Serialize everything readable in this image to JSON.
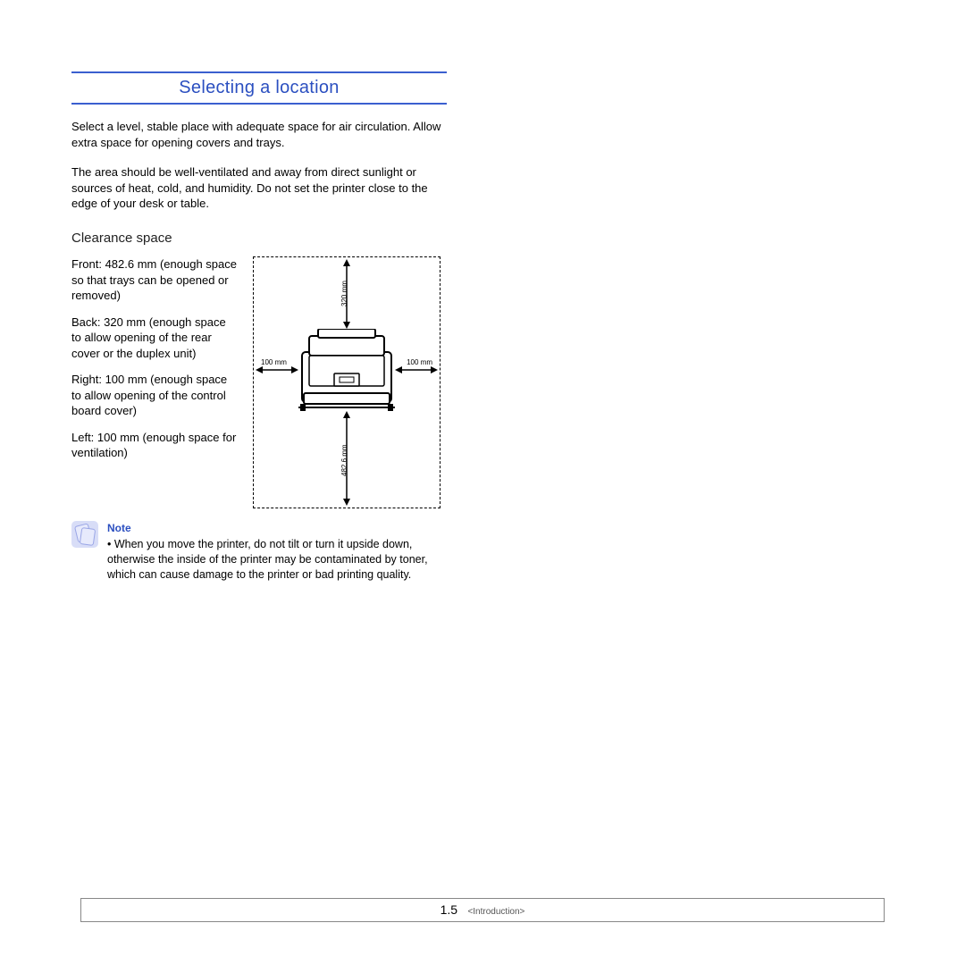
{
  "heading": "Selecting a location",
  "para1": "Select a level, stable place with adequate space for air circulation. Allow extra space for opening covers and trays.",
  "para2": "The area should be well-ventilated and away from direct sunlight or sources of heat, cold, and humidity. Do not set the printer close to the edge of your desk or table.",
  "subhead": "Clearance space",
  "clearance": {
    "front": "Front: 482.6 mm (enough space so that trays can be opened or removed)",
    "back": "Back: 320 mm (enough space to allow opening of the rear cover or the duplex unit)",
    "right": "Right: 100 mm (enough space to allow opening of the control board cover)",
    "left": "Left: 100 mm (enough space for ventilation)"
  },
  "diagram": {
    "top": "320 mm",
    "left": "100 mm",
    "right": "100 mm",
    "bottom": "482.6 mm"
  },
  "note": {
    "title": "Note",
    "text": "• When you move the printer, do not tilt or turn it upside down, otherwise the inside of the printer may be contaminated by toner, which can cause damage to the printer or bad printing quality."
  },
  "footer": {
    "page": "1.5",
    "section": "<Introduction>"
  }
}
